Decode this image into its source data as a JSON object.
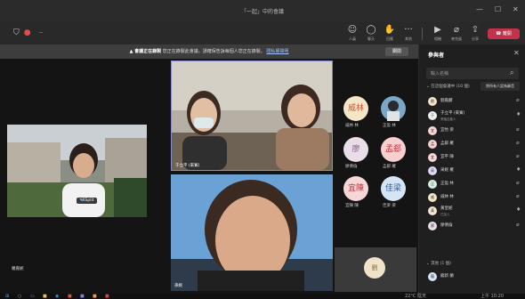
{
  "window": {
    "title": "「一起」中的會議",
    "controls": [
      "—",
      "☐",
      "✕"
    ]
  },
  "toolbar": {
    "timer": "--",
    "tools": [
      {
        "icon": "people-icon",
        "label": "人員"
      },
      {
        "icon": "chat-icon",
        "label": "聊天"
      },
      {
        "icon": "reactions-icon",
        "label": "回應"
      },
      {
        "icon": "more-icon",
        "label": "其他"
      },
      {
        "icon": "camera-icon",
        "label": "相機"
      },
      {
        "icon": "mic-icon",
        "label": "麥克風"
      },
      {
        "icon": "share-icon",
        "label": "分享"
      }
    ],
    "leave_label": "離開"
  },
  "banner": {
    "title": "▲ 會議正在錄製",
    "body": "您正在錄製此會議。請確保告訴每個人您正在錄製。",
    "link": "隱私權聲明",
    "close_label": "關閉"
  },
  "videos": {
    "left_name": "羅嘉妮",
    "top_center_name": "于立平 (來賓)",
    "bottom_center_name": "孫妮",
    "xsplit_label": "XSplit",
    "self_initial": "劉"
  },
  "roster": [
    {
      "avatar": "威林",
      "name": "威林 林",
      "color": "#f3e6c6"
    },
    {
      "avatar": "",
      "name": "正盈 林",
      "color": "#7aa6c8"
    },
    {
      "avatar": "廖",
      "name": "廖倩倫",
      "color": "#e9dde8"
    },
    {
      "avatar": "孟郄",
      "name": "孟郄 羅",
      "color": "#f6cfcf"
    },
    {
      "avatar": "宜陳",
      "name": "宜陳 陳",
      "color": "#f6d6d6"
    },
    {
      "avatar": "佳梁",
      "name": "佳梁 梁",
      "color": "#d6e5f6"
    }
  ],
  "panel": {
    "title": "參與者",
    "search_placeholder": "輸入名稱",
    "section_meeting": "⌄ 在這個會議中 (10 個)",
    "mute_all": "將所有人設為靜音",
    "participants": [
      {
        "initial": "劉",
        "name": "劉嘉麟",
        "sub": "",
        "color": "#f1e3c8"
      },
      {
        "initial": "于",
        "name": "于立平 (來賓)",
        "sub": "會議召集人",
        "color": "#eeeeee"
      },
      {
        "initial": "宜",
        "name": "宜怡 梁",
        "sub": "",
        "color": "#f6d6d6"
      },
      {
        "initial": "孟",
        "name": "孟郄 羅",
        "sub": "",
        "color": "#f6cfcf"
      },
      {
        "initial": "宜",
        "name": "宜平 陳",
        "sub": "",
        "color": "#f6d6d6"
      },
      {
        "initial": "采",
        "name": "采妮 羅",
        "sub": "",
        "color": "#e0d6f6"
      },
      {
        "initial": "正",
        "name": "正盈 林",
        "sub": "",
        "color": "#d6f0e0"
      },
      {
        "initial": "威",
        "name": "威林 林",
        "sub": "",
        "color": "#f3e6c6"
      },
      {
        "initial": "黃",
        "name": "黃皇妮",
        "sub": "已加入",
        "color": "#f6e6d6"
      },
      {
        "initial": "廖",
        "name": "廖倩倫",
        "sub": "",
        "color": "#e9dde8"
      }
    ],
    "section_others": "⌄ 其他 (1 個)",
    "others": [
      {
        "initial": "龍",
        "name": "龍新 蘭",
        "sub": "",
        "color": "#d6e5f6"
      }
    ]
  },
  "taskbar": {
    "weather": "22°C 陰天",
    "time": "上午 10:20"
  }
}
